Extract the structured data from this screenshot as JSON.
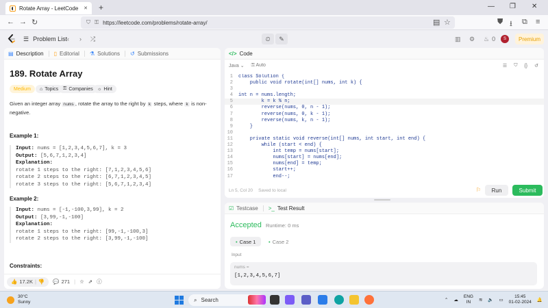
{
  "browser": {
    "tab_title": "Rotate Array - LeetCode",
    "new_tab": "+",
    "url": "https://leetcode.com/problems/rotate-array/",
    "min": "—",
    "restore": "❐",
    "close": "✕",
    "tab_close": "✕"
  },
  "header": {
    "problem_list": "Problem List",
    "streak_count": "0",
    "premium": "Premium",
    "avatar": "S"
  },
  "left": {
    "tabs": [
      "Description",
      "Editorial",
      "Solutions",
      "Submissions"
    ],
    "title": "189. Rotate Array",
    "difficulty": "Medium",
    "chips": [
      "Topics",
      "Companies",
      "Hint"
    ],
    "desc_1": "Given an integer array ",
    "desc_nums": "nums",
    "desc_2": ", rotate the array to the right by ",
    "desc_k1": "k",
    "desc_3": " steps, where ",
    "desc_k2": "k",
    "desc_4": " is non-negative.",
    "example1_title": "Example 1:",
    "example1": {
      "input_label": "Input:",
      "input": " nums = [1,2,3,4,5,6,7], k = 3",
      "output_label": "Output:",
      "output": " [5,6,7,1,2,3,4]",
      "expl_label": "Explanation:",
      "lines": [
        "rotate 1 steps to the right: [7,1,2,3,4,5,6]",
        "rotate 2 steps to the right: [6,7,1,2,3,4,5]",
        "rotate 3 steps to the right: [5,6,7,1,2,3,4]"
      ]
    },
    "example2_title": "Example 2:",
    "example2": {
      "input_label": "Input:",
      "input": " nums = [-1,-100,3,99], k = 2",
      "output_label": "Output:",
      "output": " [3,99,-1,-100]",
      "expl_label": "Explanation:",
      "lines": [
        "rotate 1 steps to the right: [99,-1,-100,3]",
        "rotate 2 steps to the right: [3,99,-1,-100]"
      ]
    },
    "constraints": "Constraints:",
    "likes": "17.2K",
    "comments": "271"
  },
  "code": {
    "title": "Code",
    "language": "Java",
    "mode": "Auto",
    "lines": [
      "class Solution {",
      "    public void rotate(int[] nums, int k) {",
      "",
      "int n = nums.length;",
      "        k = k % n;",
      "        reverse(nums, 0, n - 1);",
      "        reverse(nums, 0, k - 1);",
      "        reverse(nums, k, n - 1);",
      "    }",
      "",
      "    private static void reverse(int[] nums, int start, int end) {",
      "        while (start < end) {",
      "            int temp = nums[start];",
      "            nums[start] = nums[end];",
      "            nums[end] = temp;",
      "            start++;",
      "            end--;"
    ],
    "cursor": "Ln 5, Col 20",
    "saved": "Saved to local",
    "run": "Run",
    "submit": "Submit"
  },
  "test": {
    "tab_testcase": "Testcase",
    "tab_result": "Test Result",
    "status": "Accepted",
    "runtime": "Runtime: 0 ms",
    "case1": "Case 1",
    "case2": "Case 2",
    "input_label": "Input",
    "input_name": "nums =",
    "input_value": "[1,2,3,4,5,6,7]"
  },
  "taskbar": {
    "temp": "30°C",
    "weather": "Sunny",
    "search": "Search",
    "lang1": "ENG",
    "lang2": "IN",
    "time": "15:45",
    "date": "01-02-2024"
  },
  "colors": {
    "accepted": "#2cbb5d",
    "submit": "#2cbb5d",
    "difficulty": "#ffb800",
    "premium": "#e8a000"
  }
}
